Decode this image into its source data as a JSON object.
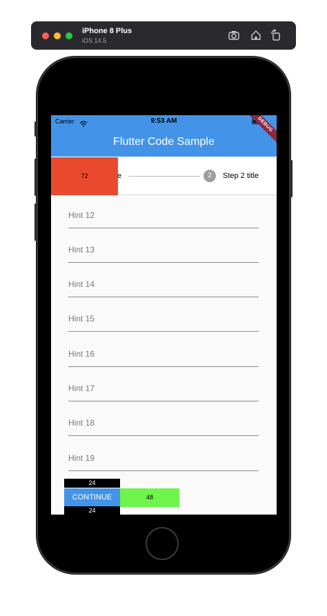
{
  "simulator": {
    "device": "iPhone 8 Plus",
    "os": "iOS 14.5"
  },
  "status_bar": {
    "carrier": "Carrier",
    "time": "9:53 AM"
  },
  "app_bar": {
    "title": "Flutter Code Sample",
    "debug_banner": "DEBUG"
  },
  "stepper": {
    "step1_label_fragment": "e",
    "step2_number": "2",
    "step2_title": "Step 2 title",
    "overlay_box_value": "72"
  },
  "fields": [
    {
      "hint": "Hint 12"
    },
    {
      "hint": "Hint 13"
    },
    {
      "hint": "Hint 14"
    },
    {
      "hint": "Hint 15"
    },
    {
      "hint": "Hint 16"
    },
    {
      "hint": "Hint 17"
    },
    {
      "hint": "Hint 18"
    },
    {
      "hint": "Hint 19"
    }
  ],
  "controls": {
    "top_box_value": "24",
    "continue_label": "CONTINUE",
    "green_box_value": "48",
    "bottom_box_value": "24"
  },
  "colors": {
    "app_bar": "#4394e8",
    "red_box": "#e94a2e",
    "green_box": "#6ef44c",
    "debug_banner": "#8b2942"
  }
}
